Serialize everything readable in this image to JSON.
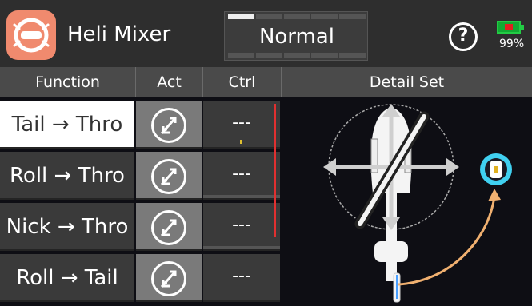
{
  "header": {
    "title": "Heli Mixer",
    "mode": "Normal",
    "battery_percent": "99%",
    "help_label": "?"
  },
  "columns": [
    "Function",
    "Act",
    "Ctrl",
    "Detail Set"
  ],
  "rows": [
    {
      "function": "Tail → Thro",
      "ctrl": "---",
      "selected": true
    },
    {
      "function": "Roll → Thro",
      "ctrl": "---",
      "selected": false
    },
    {
      "function": "Nick → Thro",
      "ctrl": "---",
      "selected": false
    },
    {
      "function": "Roll → Tail",
      "ctrl": "---",
      "selected": false
    }
  ],
  "icons": {
    "app": "heli-mixer-icon",
    "help": "help-icon",
    "battery": "battery-icon",
    "act": "switch-icon",
    "detail": "helicopter-diagram"
  },
  "colors": {
    "accent": "#f08a6e",
    "selected_row": "#ffffff",
    "battery": "#22cc44",
    "arrow": "#f0b070",
    "gyro_ring": "#40d0f0",
    "ctrl_limit": "#e03030"
  }
}
